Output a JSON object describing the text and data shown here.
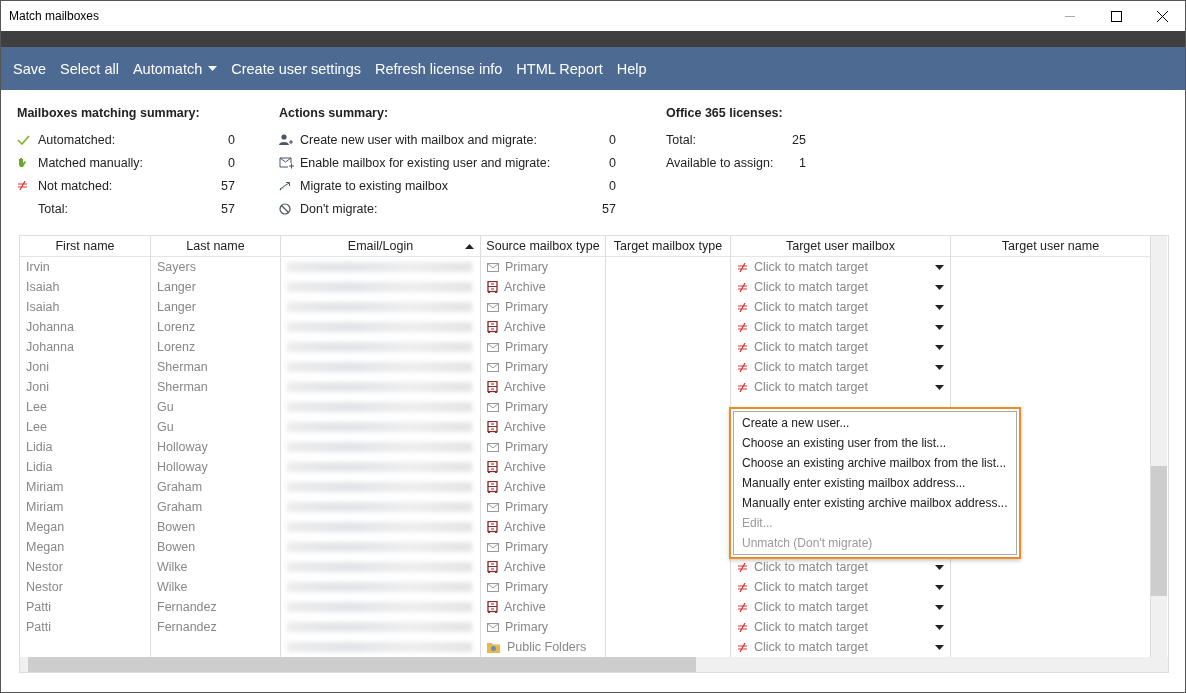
{
  "window": {
    "title": "Match mailboxes"
  },
  "toolbar": [
    {
      "label": "Save",
      "dropdown": false
    },
    {
      "label": "Select all",
      "dropdown": false
    },
    {
      "label": "Automatch",
      "dropdown": true
    },
    {
      "label": "Create user settings",
      "dropdown": false
    },
    {
      "label": "Refresh license info",
      "dropdown": false
    },
    {
      "label": "HTML Report",
      "dropdown": false
    },
    {
      "label": "Help",
      "dropdown": false
    }
  ],
  "summaries": [
    {
      "title": "Mailboxes matching summary:",
      "items": [
        {
          "kind": "automatched",
          "label": "Automatched:",
          "value": "0"
        },
        {
          "kind": "manual",
          "label": "Matched manually:",
          "value": "0"
        },
        {
          "kind": "not_matched",
          "label": "Not matched:",
          "value": "57"
        },
        {
          "kind": "none",
          "label": "Total:",
          "value": "57"
        }
      ]
    },
    {
      "title": "Actions summary:",
      "items": [
        {
          "kind": "new_user",
          "label": "Create new user with mailbox and migrate:",
          "value": "0"
        },
        {
          "kind": "enable_mailbox",
          "label": "Enable mailbox for existing user and migrate:",
          "value": "0"
        },
        {
          "kind": "migrate_existing",
          "label": "Migrate to existing mailbox",
          "value": "0"
        },
        {
          "kind": "dont_migrate",
          "label": "Don't migrate:",
          "value": "57"
        }
      ]
    },
    {
      "title": "Office 365 licenses:",
      "items": [
        {
          "kind": "plain",
          "label": "Total:",
          "value": "25"
        },
        {
          "kind": "plain",
          "label": "Available to assign:",
          "value": "1"
        }
      ]
    }
  ],
  "table": {
    "columns": [
      {
        "label": "First name",
        "sorted": false
      },
      {
        "label": "Last name",
        "sorted": false
      },
      {
        "label": "Email/Login",
        "sorted": true
      },
      {
        "label": "Source mailbox type",
        "sorted": false
      },
      {
        "label": "Target mailbox type",
        "sorted": false
      },
      {
        "label": "Target user mailbox",
        "sorted": false
      },
      {
        "label": "Target user name",
        "sorted": false
      }
    ],
    "rows": [
      {
        "first": "Irvin",
        "last": "Sayers",
        "source": {
          "kind": "primary",
          "label": "Primary"
        },
        "target": "Click to match target"
      },
      {
        "first": "Isaiah",
        "last": "Langer",
        "source": {
          "kind": "archive",
          "label": "Archive"
        },
        "target": "Click to match target"
      },
      {
        "first": "Isaiah",
        "last": "Langer",
        "source": {
          "kind": "primary",
          "label": "Primary"
        },
        "target": "Click to match target"
      },
      {
        "first": "Johanna",
        "last": "Lorenz",
        "source": {
          "kind": "archive",
          "label": "Archive"
        },
        "target": "Click to match target"
      },
      {
        "first": "Johanna",
        "last": "Lorenz",
        "source": {
          "kind": "primary",
          "label": "Primary"
        },
        "target": "Click to match target"
      },
      {
        "first": "Joni",
        "last": "Sherman",
        "source": {
          "kind": "primary",
          "label": "Primary"
        },
        "target": "Click to match target"
      },
      {
        "first": "Joni",
        "last": "Sherman",
        "source": {
          "kind": "archive",
          "label": "Archive"
        },
        "target": "Click to match target"
      },
      {
        "first": "Lee",
        "last": "Gu",
        "source": {
          "kind": "primary",
          "label": "Primary"
        }
      },
      {
        "first": "Lee",
        "last": "Gu",
        "source": {
          "kind": "archive",
          "label": "Archive"
        }
      },
      {
        "first": "Lidia",
        "last": "Holloway",
        "source": {
          "kind": "primary",
          "label": "Primary"
        }
      },
      {
        "first": "Lidia",
        "last": "Holloway",
        "source": {
          "kind": "archive",
          "label": "Archive"
        }
      },
      {
        "first": "Miriam",
        "last": "Graham",
        "source": {
          "kind": "archive",
          "label": "Archive"
        }
      },
      {
        "first": "Miriam",
        "last": "Graham",
        "source": {
          "kind": "primary",
          "label": "Primary"
        }
      },
      {
        "first": "Megan",
        "last": "Bowen",
        "source": {
          "kind": "archive",
          "label": "Archive"
        }
      },
      {
        "first": "Megan",
        "last": "Bowen",
        "source": {
          "kind": "primary",
          "label": "Primary"
        }
      },
      {
        "first": "Nestor",
        "last": "Wilke",
        "source": {
          "kind": "archive",
          "label": "Archive"
        },
        "target": "Click to match target"
      },
      {
        "first": "Nestor",
        "last": "Wilke",
        "source": {
          "kind": "primary",
          "label": "Primary"
        },
        "target": "Click to match target"
      },
      {
        "first": "Patti",
        "last": "Fernandez",
        "source": {
          "kind": "archive",
          "label": "Archive"
        },
        "target": "Click to match target"
      },
      {
        "first": "Patti",
        "last": "Fernandez",
        "source": {
          "kind": "primary",
          "label": "Primary"
        },
        "target": "Click to match target"
      },
      {
        "source": {
          "kind": "public_folders",
          "label": "Public Folders"
        },
        "target": "Click to match target"
      }
    ]
  },
  "context_menu": [
    {
      "label": "Create a new user...",
      "disabled": false
    },
    {
      "label": "Choose an existing user from the list...",
      "disabled": false
    },
    {
      "label": "Choose an existing archive mailbox from the list...",
      "disabled": false
    },
    {
      "label": "Manually enter existing mailbox address...",
      "disabled": false
    },
    {
      "label": "Manually enter existing archive mailbox address...",
      "disabled": false
    },
    {
      "label": "Edit...",
      "disabled": true
    },
    {
      "label": "Unmatch (Don't migrate)",
      "disabled": true
    }
  ]
}
